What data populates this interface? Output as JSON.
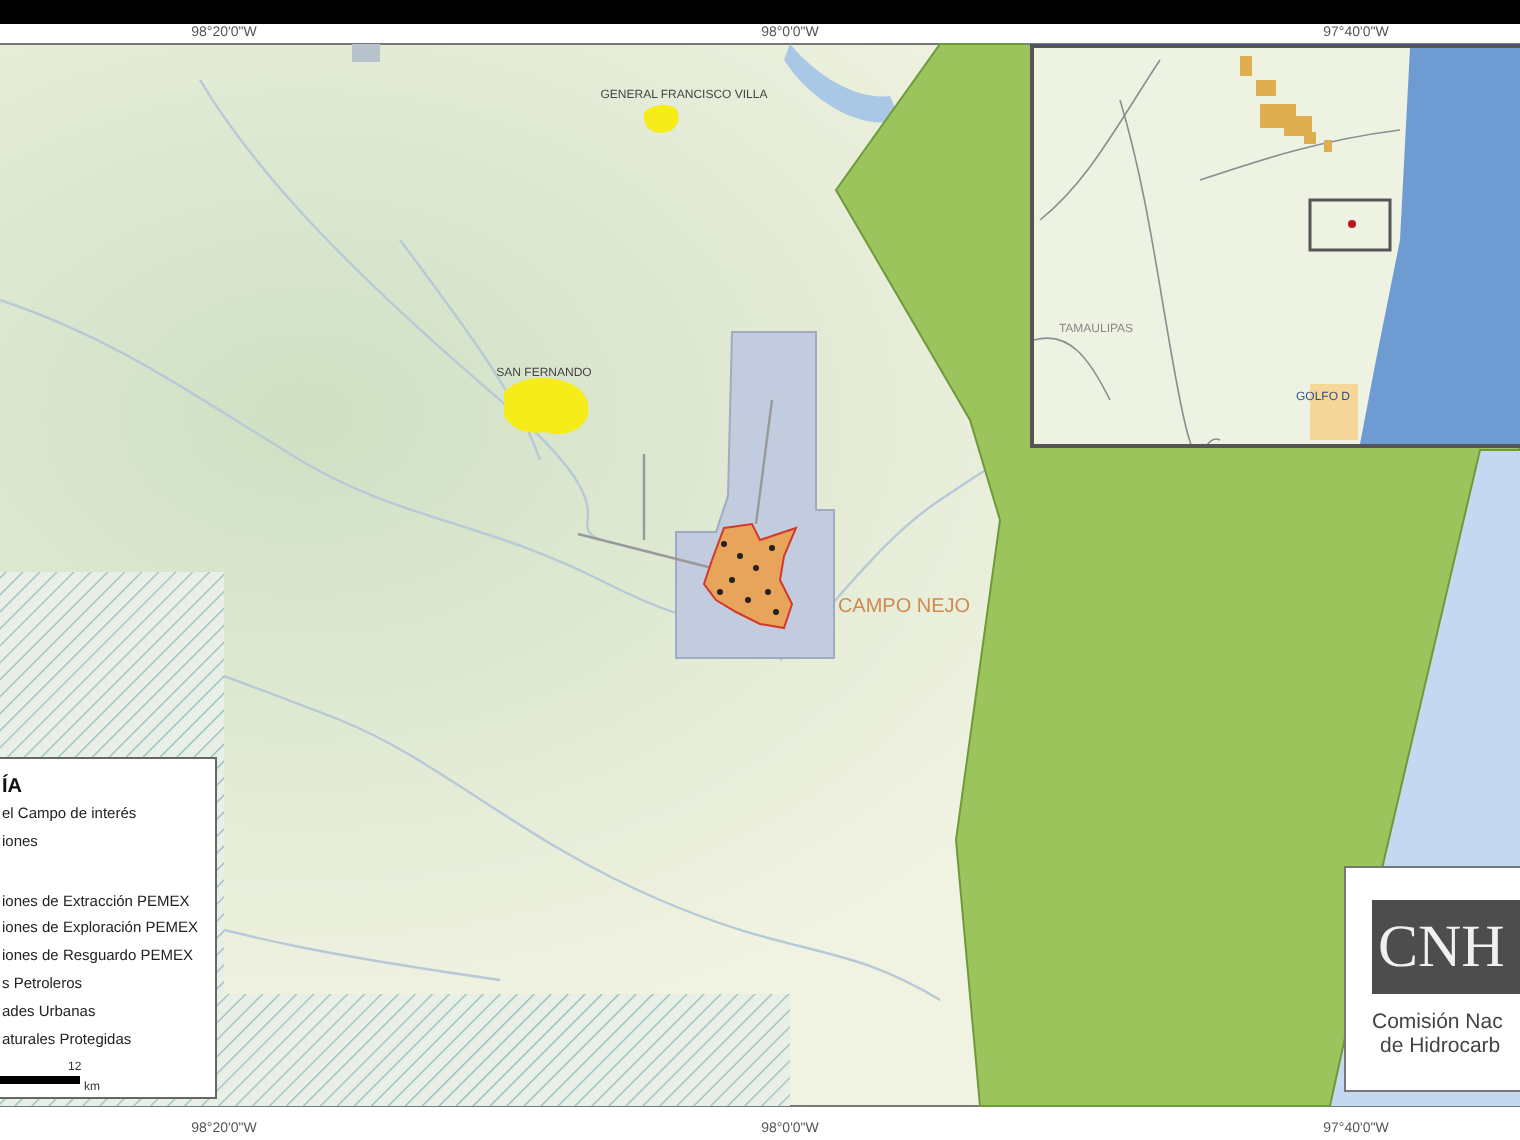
{
  "coordinates": {
    "top": [
      "98°20'0\"W",
      "98°0'0\"W",
      "97°40'0\"W"
    ],
    "bottom": [
      "98°20'0\"W",
      "98°0'0\"W",
      "97°40'0\"W"
    ]
  },
  "map_labels": [
    {
      "kind": "town",
      "text": "GENERAL FRANCISCO VILLA"
    },
    {
      "kind": "town",
      "text": "SAN FERNANDO"
    },
    {
      "kind": "field",
      "text": "CAMPO NEJO"
    }
  ],
  "inset": {
    "labels": [
      {
        "kind": "state",
        "text": "TAMAULIPAS"
      },
      {
        "kind": "sea",
        "text": "GOLFO D"
      }
    ]
  },
  "legend": {
    "title": "ÍA",
    "items": [
      "el Campo de interés",
      "iones",
      "iones de Extracción PEMEX",
      "iones de Exploración PEMEX",
      "iones de Resguardo PEMEX",
      "s Petroleros",
      "ades Urbanas",
      "aturales Protegidas"
    ],
    "scale": {
      "value": "12",
      "unit": "km"
    }
  },
  "logo": {
    "acronym": "CNH",
    "lines": [
      "Comisión Nac",
      "de Hidrocarb"
    ]
  }
}
